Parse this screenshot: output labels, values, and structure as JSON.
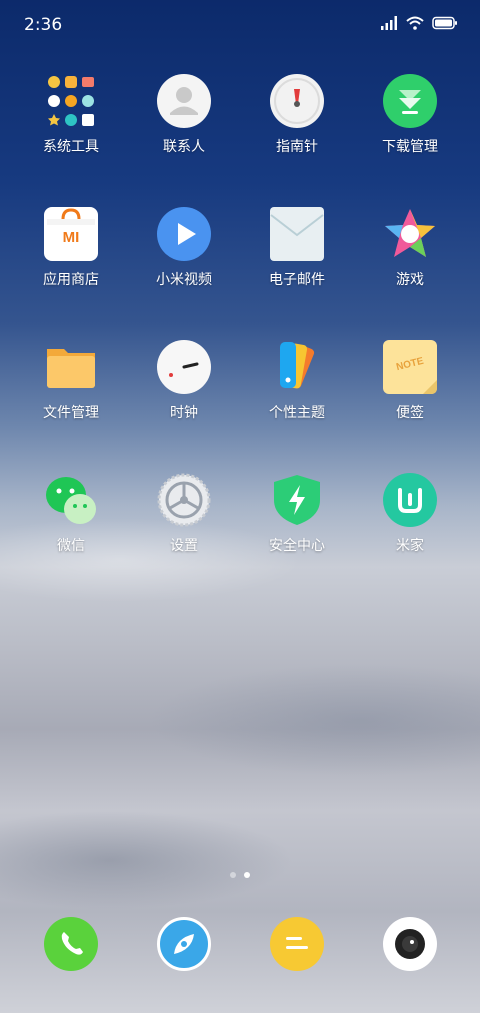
{
  "status_bar": {
    "time": "2:36"
  },
  "apps": [
    {
      "label": "系统工具",
      "icon": "system-tools-folder-icon"
    },
    {
      "label": "联系人",
      "icon": "contacts-icon"
    },
    {
      "label": "指南针",
      "icon": "compass-icon"
    },
    {
      "label": "下载管理",
      "icon": "download-manager-icon"
    },
    {
      "label": "应用商店",
      "icon": "app-store-icon"
    },
    {
      "label": "小米视频",
      "icon": "mi-video-icon"
    },
    {
      "label": "电子邮件",
      "icon": "email-icon"
    },
    {
      "label": "游戏",
      "icon": "games-icon"
    },
    {
      "label": "文件管理",
      "icon": "file-manager-icon"
    },
    {
      "label": "时钟",
      "icon": "clock-icon"
    },
    {
      "label": "个性主题",
      "icon": "themes-icon"
    },
    {
      "label": "便签",
      "icon": "notes-icon"
    },
    {
      "label": "微信",
      "icon": "wechat-icon"
    },
    {
      "label": "设置",
      "icon": "settings-icon"
    },
    {
      "label": "安全中心",
      "icon": "security-icon"
    },
    {
      "label": "米家",
      "icon": "mi-home-icon"
    }
  ],
  "notes_icon_text": "NOTE",
  "app_store_icon_text": "MI",
  "dock": [
    {
      "icon": "phone-icon",
      "color": "#5ad23c"
    },
    {
      "icon": "browser-icon",
      "color": "#3aa7e8"
    },
    {
      "icon": "messaging-icon",
      "color": "#f7c933"
    },
    {
      "icon": "camera-icon",
      "color": "#ffffff"
    }
  ],
  "page_indicator": {
    "pages": 2,
    "active_page": 2
  }
}
